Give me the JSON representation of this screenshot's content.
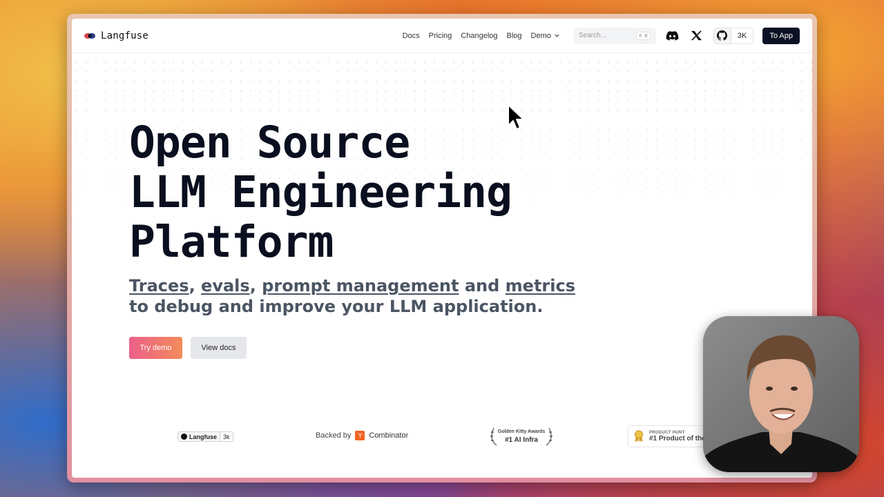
{
  "brand": {
    "name": "Langfuse",
    "logo_icon": "langfuse-logo-icon"
  },
  "nav": {
    "links": [
      "Docs",
      "Pricing",
      "Changelog",
      "Blog",
      "Demo"
    ],
    "search_placeholder": "Search...",
    "search_shortcut": "⌘ K",
    "github_stars": "3K",
    "to_app": "To App"
  },
  "hero": {
    "title_lines": [
      "Open Source",
      "LLM Engineering",
      "Platform"
    ],
    "subtitle": {
      "link1": "Traces",
      "sep1": ", ",
      "link2": "evals",
      "sep2": ", ",
      "link3": "prompt management",
      "and": " and ",
      "link4": "metrics",
      "line2": "to debug and improve your LLM application."
    },
    "try_demo": "Try demo",
    "view_docs": "View docs"
  },
  "badges": {
    "github": {
      "label": "Langfuse",
      "count": "3k"
    },
    "yc": {
      "prefix": "Backed by",
      "logo": "Y",
      "name": "Combinator"
    },
    "kitty": {
      "line1": "Golden Kitty Awards",
      "line2": "#1 AI Infra"
    },
    "producthunt": {
      "line1": "PRODUCT HUNT",
      "line2": "#1 Product of the"
    }
  },
  "colors": {
    "primary_dark": "#0b1024",
    "demo_gradient_start": "#ec5f8a",
    "demo_gradient_end": "#f28b5a",
    "subtitle_gray": "#4b5563"
  }
}
